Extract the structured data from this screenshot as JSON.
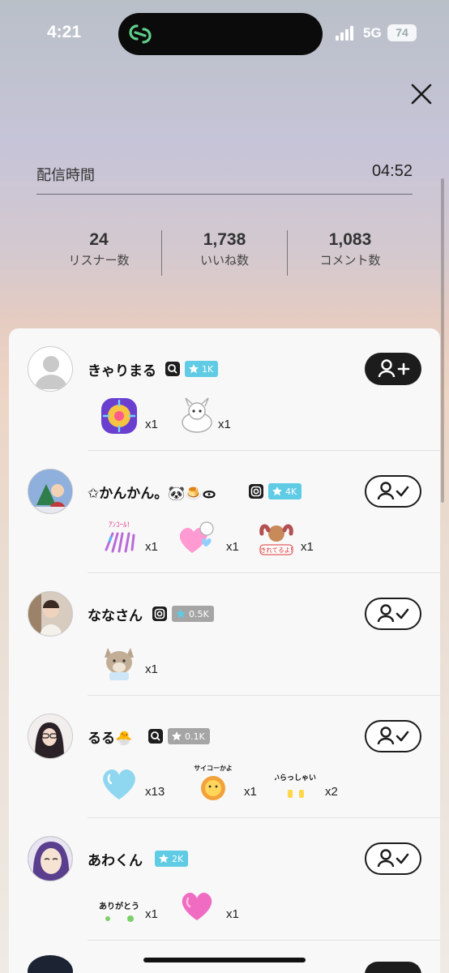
{
  "status_bar": {
    "time": "4:21",
    "network": "5G",
    "battery": "74"
  },
  "stream": {
    "label": "配信時間",
    "value": "04:52"
  },
  "stats": [
    {
      "value": "24",
      "label": "リスナー数"
    },
    {
      "value": "1,738",
      "label": "いいね数"
    },
    {
      "value": "1,083",
      "label": "コメント数"
    }
  ],
  "users": [
    {
      "name": "きゃりまる",
      "badge": "1K",
      "followed": false,
      "gifts": [
        {
          "icon": "firework-sticker",
          "count": "x1"
        },
        {
          "icon": "white-animal-sticker",
          "count": "x1"
        }
      ]
    },
    {
      "name": "✩かんかん。🐼🍮ᯣ",
      "badge": "4K",
      "followed": true,
      "gifts": [
        {
          "icon": "anko-call-sticker",
          "count": "x1"
        },
        {
          "icon": "pink-heart-sticker",
          "count": "x1"
        },
        {
          "icon": "muscle-sticker",
          "count": "x1"
        }
      ]
    },
    {
      "name": "ななさん",
      "badge": "0.5K",
      "followed": true,
      "gifts": [
        {
          "icon": "shiba-sticker",
          "count": "x1"
        }
      ]
    },
    {
      "name": "るる🐣",
      "badge": "0.1K",
      "followed": true,
      "gifts": [
        {
          "icon": "blue-heart-sticker",
          "count": "x13"
        },
        {
          "icon": "saiko-lion-sticker",
          "count": "x1"
        },
        {
          "icon": "irasshai-sticker",
          "count": "x2"
        }
      ]
    },
    {
      "name": "あわくん",
      "badge": "2K",
      "followed": true,
      "gifts": [
        {
          "icon": "arigatou-sticker",
          "count": "x1"
        },
        {
          "icon": "pink-heart-sticker",
          "count": "x1"
        }
      ]
    }
  ],
  "sticker_text": {
    "anko": "ｱﾝｺｰﾙ!",
    "muscle": "きれてるよ!",
    "saiko": "サイコーかよ",
    "irasshai": "いらっしゃい!",
    "arigatou": "ありがとう"
  },
  "colors": {
    "badge_blue": "#5fcbe4",
    "badge_gray": "#a5a5a5",
    "follow_dark": "#1c1c1c"
  }
}
